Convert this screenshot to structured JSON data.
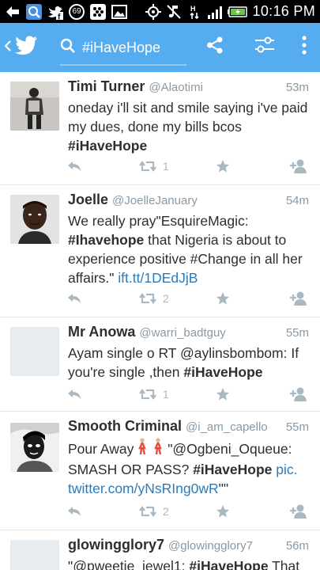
{
  "status_bar": {
    "time": "10:16 PM",
    "notification_badge": "69",
    "icons": [
      "back-arrow-icon",
      "search-app-icon",
      "twitter-facebook-icon",
      "badge-icon",
      "bbm-icon",
      "gallery-icon",
      "gps-icon",
      "mute-icon",
      "data-icon",
      "signal-icon",
      "battery-icon"
    ]
  },
  "app_bar": {
    "search_query": "#iHaveHope",
    "color": "#55acee"
  },
  "tweets": [
    {
      "name": "Timi Turner",
      "handle": "@Alaotimi",
      "time": "53m",
      "line1": "oneday i'll sit and smile saying i've paid",
      "line2": "my dues, done my bills bcos",
      "hashtag": "#iHaveHope",
      "retweets": "1"
    },
    {
      "name": "Joelle",
      "handle": "@JoelleJanuary",
      "time": "54m",
      "line1": "We really pray\"EsquireMagic:",
      "hashtag": "#Ihavehope",
      "line2_rest": " that Nigeria is about to",
      "line3": "experience positive #Change in all her",
      "line4": "affairs.\" ",
      "link": "ift.tt/1DEdJjB",
      "retweets": "2"
    },
    {
      "name": "Mr Anowa",
      "handle": "@warri_badtguy",
      "time": "55m",
      "line1": "Ayam single o RT @aylinsbombom: If",
      "line2": "you're single ,then ",
      "hashtag": "#iHaveHope",
      "retweets": "1"
    },
    {
      "name": "Smooth Criminal",
      "handle": "@i_am_capello",
      "time": "55m",
      "line1_a": "Pour Away ",
      "line1_b": " \"@Ogbeni_Oqueue:",
      "line2": "SMASH OR PASS? ",
      "hashtag": "#iHaveHope",
      "link_a": " pic.",
      "link_b": "twitter.com/yNsRIng0wR",
      "tail": "\"\"",
      "retweets": "2"
    },
    {
      "name": "glowingglory7",
      "handle": "@glowingglory7",
      "time": "56m",
      "line1": "\"@pweetie_jewel1: ",
      "hashtag": "#iHaveHope",
      "line1_rest": " That"
    }
  ]
}
